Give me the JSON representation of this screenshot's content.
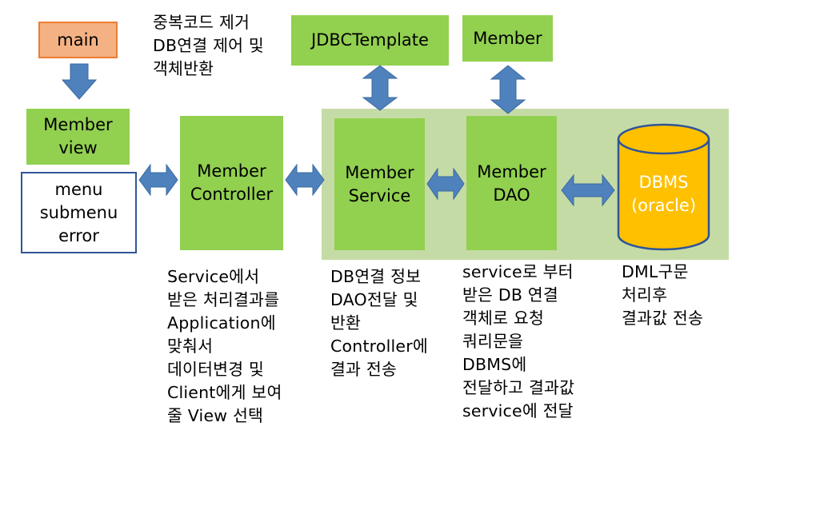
{
  "colors": {
    "green": "#92d050",
    "panel": "#c5dba6",
    "orange": "#f4b183",
    "orange_border": "#ed7d31",
    "arrow_fill": "#4f81bd",
    "db_fill": "#ffc000",
    "db_border": "#2f5597"
  },
  "nodes": {
    "main": "main",
    "member_view": "Member\nview",
    "menu_box": "menu\nsubmenu\nerror",
    "controller": "Member\nController",
    "service": "Member\nService",
    "dao": "Member\nDAO",
    "jdbc_template": "JDBCTemplate",
    "member": "Member",
    "dbms": "DBMS\n(oracle)"
  },
  "notes": {
    "template_note": "중복코드 제거\nDB연결 제어 및\n객체반환",
    "controller_note": "Service에서\n받은 처리결과를\nApplication에\n맞춰서\n데이터변경 및\nClient에게 보여\n줄 View 선택",
    "service_note": "DB연결 정보\nDAO전달 및\n반환\nController에\n결과 전송",
    "dao_note": "service로 부터\n받은 DB 연결\n객체로 요청\n쿼리문을\nDBMS에\n전달하고 결과값\nservice에 전달",
    "dbms_note": "DML구문\n처리후\n결과값 전송"
  },
  "icons": {
    "down_arrow": "block-arrow-down",
    "double_arrow": "block-arrow-left-right",
    "vertical_double_arrow": "block-arrow-up-down",
    "database": "cylinder"
  }
}
